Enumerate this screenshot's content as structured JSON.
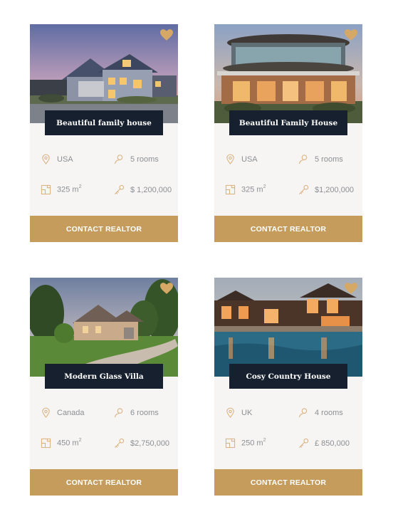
{
  "colors": {
    "accent": "#c59c5c",
    "title_bg": "#16202e",
    "card_bg": "#f7f5f3",
    "muted_text": "#8b8f94"
  },
  "icons": {
    "favorite": "heart-icon",
    "location": "map-pin-icon",
    "rooms": "user-icon",
    "area": "floor-plan-icon",
    "price": "key-icon"
  },
  "listings": [
    {
      "title": "Beautiful family house",
      "location": "USA",
      "rooms": "5 rooms",
      "area_value": "325 m",
      "area_sup": "2",
      "price": "$ 1,200,000",
      "cta": "CONTACT REALTOR"
    },
    {
      "title": "Beautiful Family House",
      "location": "USA",
      "rooms": "5 rooms",
      "area_value": "325 m",
      "area_sup": "2",
      "price": "$1,200,000",
      "cta": "CONTACT REALTOR"
    },
    {
      "title": "Modern Glass Villa",
      "location": "Canada",
      "rooms": "6 rooms",
      "area_value": "450 m",
      "area_sup": "2",
      "price": "$2,750,000",
      "cta": "CONTACT REALTOR"
    },
    {
      "title": "Cosy Country House",
      "location": "UK",
      "rooms": "4 rooms",
      "area_value": "250 m",
      "area_sup": "2",
      "price": "£ 850,000",
      "cta": "CONTACT REALTOR"
    }
  ]
}
